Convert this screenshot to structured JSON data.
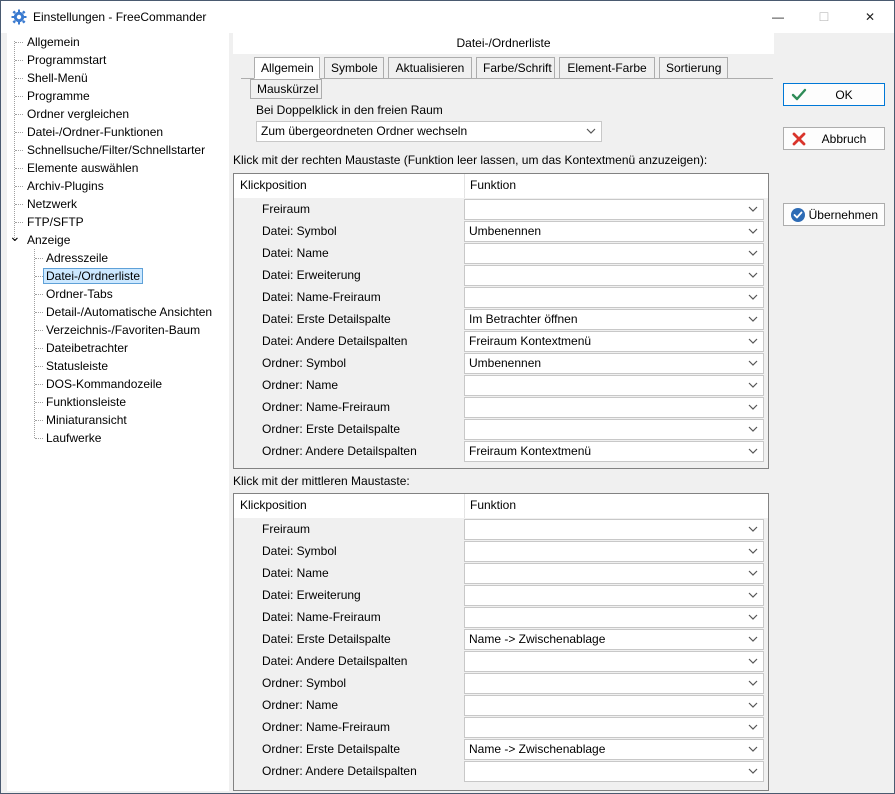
{
  "window": {
    "title": "Einstellungen - FreeCommander",
    "controls": {
      "minimize": "—",
      "maximize": "☐",
      "close": "✕"
    }
  },
  "tree": {
    "items": [
      {
        "label": "Allgemein"
      },
      {
        "label": "Programmstart"
      },
      {
        "label": "Shell-Menü"
      },
      {
        "label": "Programme"
      },
      {
        "label": "Ordner vergleichen"
      },
      {
        "label": "Datei-/Ordner-Funktionen"
      },
      {
        "label": "Schnellsuche/Filter/Schnellstarter"
      },
      {
        "label": "Elemente auswählen"
      },
      {
        "label": "Archiv-Plugins"
      },
      {
        "label": "Netzwerk"
      },
      {
        "label": "FTP/SFTP"
      },
      {
        "label": "Anzeige"
      }
    ],
    "sub_items": [
      {
        "label": "Adresszeile"
      },
      {
        "label": "Datei-/Ordnerliste"
      },
      {
        "label": "Ordner-Tabs"
      },
      {
        "label": "Detail-/Automatische Ansichten"
      },
      {
        "label": "Verzeichnis-/Favoriten-Baum"
      },
      {
        "label": "Dateibetrachter"
      },
      {
        "label": "Statusleiste"
      },
      {
        "label": "DOS-Kommandozeile"
      },
      {
        "label": "Funktionsleiste"
      },
      {
        "label": "Miniaturansicht"
      },
      {
        "label": "Laufwerke"
      }
    ],
    "expand_glyph": "⌄"
  },
  "page": {
    "header": "Datei-/Ordnerliste",
    "tabs_row1": [
      "Allgemein",
      "Symbole",
      "Aktualisieren",
      "Farbe/Schrift",
      "Element-Farbe",
      "Sortierung"
    ],
    "tabs_row2": [
      "Mauskürzel"
    ],
    "double_click_label": "Bei Doppelklick in den freien Raum",
    "double_click_value": "Zum übergeordneten Ordner wechseln",
    "right_click_label": "Klick mit der rechten Maustaste (Funktion leer lassen, um das Kontextmenü anzuzeigen):",
    "middle_click_label": "Klick mit der mittleren Maustaste:",
    "col_position": "Klickposition",
    "col_function": "Funktion"
  },
  "right_click_rows": [
    {
      "position": "Freiraum",
      "function": ""
    },
    {
      "position": "Datei: Symbol",
      "function": "Umbenennen"
    },
    {
      "position": "Datei: Name",
      "function": ""
    },
    {
      "position": "Datei: Erweiterung",
      "function": ""
    },
    {
      "position": "Datei: Name-Freiraum",
      "function": ""
    },
    {
      "position": "Datei: Erste Detailspalte",
      "function": "Im Betrachter öffnen"
    },
    {
      "position": "Datei: Andere Detailspalten",
      "function": "Freiraum Kontextmenü"
    },
    {
      "position": "Ordner: Symbol",
      "function": "Umbenennen"
    },
    {
      "position": "Ordner: Name",
      "function": ""
    },
    {
      "position": "Ordner: Name-Freiraum",
      "function": ""
    },
    {
      "position": "Ordner: Erste Detailspalte",
      "function": ""
    },
    {
      "position": "Ordner: Andere Detailspalten",
      "function": "Freiraum Kontextmenü"
    }
  ],
  "middle_click_rows": [
    {
      "position": "Freiraum",
      "function": ""
    },
    {
      "position": "Datei: Symbol",
      "function": ""
    },
    {
      "position": "Datei: Name",
      "function": ""
    },
    {
      "position": "Datei: Erweiterung",
      "function": ""
    },
    {
      "position": "Datei: Name-Freiraum",
      "function": ""
    },
    {
      "position": "Datei: Erste Detailspalte",
      "function": "Name -> Zwischenablage"
    },
    {
      "position": "Datei: Andere Detailspalten",
      "function": ""
    },
    {
      "position": "Ordner: Symbol",
      "function": ""
    },
    {
      "position": "Ordner: Name",
      "function": ""
    },
    {
      "position": "Ordner: Name-Freiraum",
      "function": ""
    },
    {
      "position": "Ordner: Erste Detailspalte",
      "function": "Name -> Zwischenablage"
    },
    {
      "position": "Ordner: Andere Detailspalten",
      "function": ""
    }
  ],
  "buttons": {
    "ok": "OK",
    "cancel": "Abbruch",
    "apply": "Übernehmen"
  },
  "colors": {
    "ok_icon": "#2e8b57",
    "cancel_icon": "#d9342b",
    "apply_icon": "#2d6bb5",
    "selection_bg": "#cce8ff",
    "selection_border": "#5fa1d8",
    "default_button_border": "#0078d7"
  }
}
